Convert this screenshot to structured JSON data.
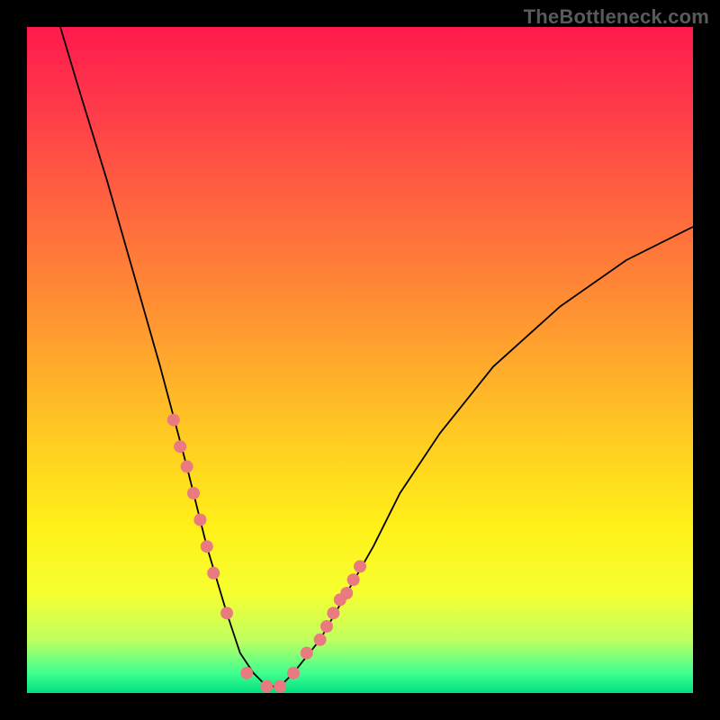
{
  "watermark": "TheBottleneck.com",
  "chart_data": {
    "type": "line",
    "title": "",
    "xlabel": "",
    "ylabel": "",
    "xlim": [
      0,
      100
    ],
    "ylim": [
      0,
      100
    ],
    "grid": false,
    "legend": false,
    "curve": {
      "name": "bottleneck-curve",
      "x": [
        5,
        8,
        12,
        16,
        20,
        24,
        27,
        30,
        32,
        34,
        36,
        38,
        40,
        44,
        48,
        52,
        56,
        62,
        70,
        80,
        90,
        100
      ],
      "y": [
        100,
        90,
        77,
        63,
        49,
        34,
        22,
        12,
        6,
        3,
        1,
        1,
        3,
        8,
        15,
        22,
        30,
        39,
        49,
        58,
        65,
        70
      ]
    },
    "markers": {
      "name": "highlight-dots",
      "color": "#e97a80",
      "x": [
        22,
        23,
        24,
        25,
        26,
        27,
        28,
        30,
        33,
        36,
        38,
        40,
        42,
        44,
        45,
        46,
        47,
        48,
        49,
        50
      ],
      "y": [
        41,
        37,
        34,
        30,
        26,
        22,
        18,
        12,
        3,
        1,
        1,
        3,
        6,
        8,
        10,
        12,
        14,
        15,
        17,
        19
      ]
    },
    "gradient_stops": [
      {
        "pos": 0,
        "color": "#ff1a4d"
      },
      {
        "pos": 50,
        "color": "#ffa82c"
      },
      {
        "pos": 85,
        "color": "#f6ff30"
      },
      {
        "pos": 100,
        "color": "#00e080"
      }
    ]
  }
}
